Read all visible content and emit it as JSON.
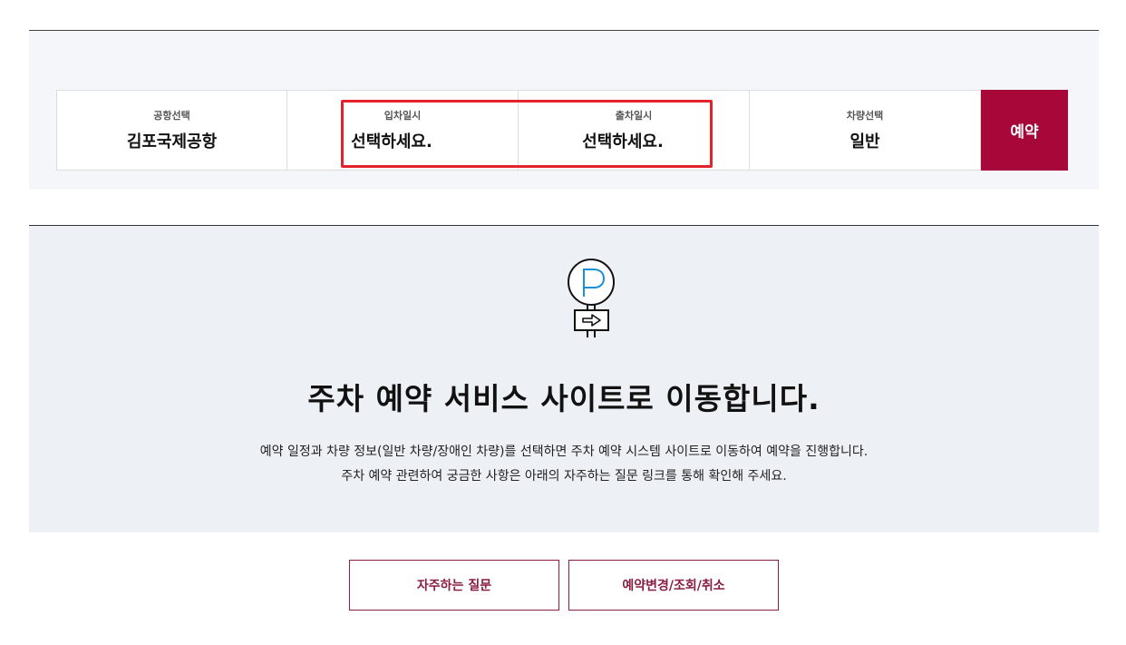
{
  "booking": {
    "airport": {
      "label": "공항선택",
      "value": "김포국제공항"
    },
    "entry": {
      "label": "입차일시",
      "value": "선택하세요."
    },
    "exit": {
      "label": "출차일시",
      "value": "선택하세요."
    },
    "vehicle": {
      "label": "차량선택",
      "value": "일반"
    },
    "reserve_label": "예약"
  },
  "info": {
    "icon": "parking-sign-icon",
    "title": "주차 예약 서비스 사이트로 이동합니다.",
    "desc_line1": "예약 일정과 차량 정보(일반 차량/장애인 차량)를 선택하면 주차 예약 시스템 사이트로 이동하여 예약을 진행합니다.",
    "desc_line2": "주차 예약 관련하여 궁금한 사항은 아래의 자주하는 질문 링크를 통해 확인해 주세요."
  },
  "links": {
    "faq_label": "자주하는 질문",
    "manage_label": "예약변경/조회/취소"
  },
  "colors": {
    "accent": "#a8073a",
    "highlight": "#e3232c",
    "panel_bg": "#f4f6f9",
    "info_bg": "#edf0f4",
    "icon_blue": "#1a8fd6"
  }
}
